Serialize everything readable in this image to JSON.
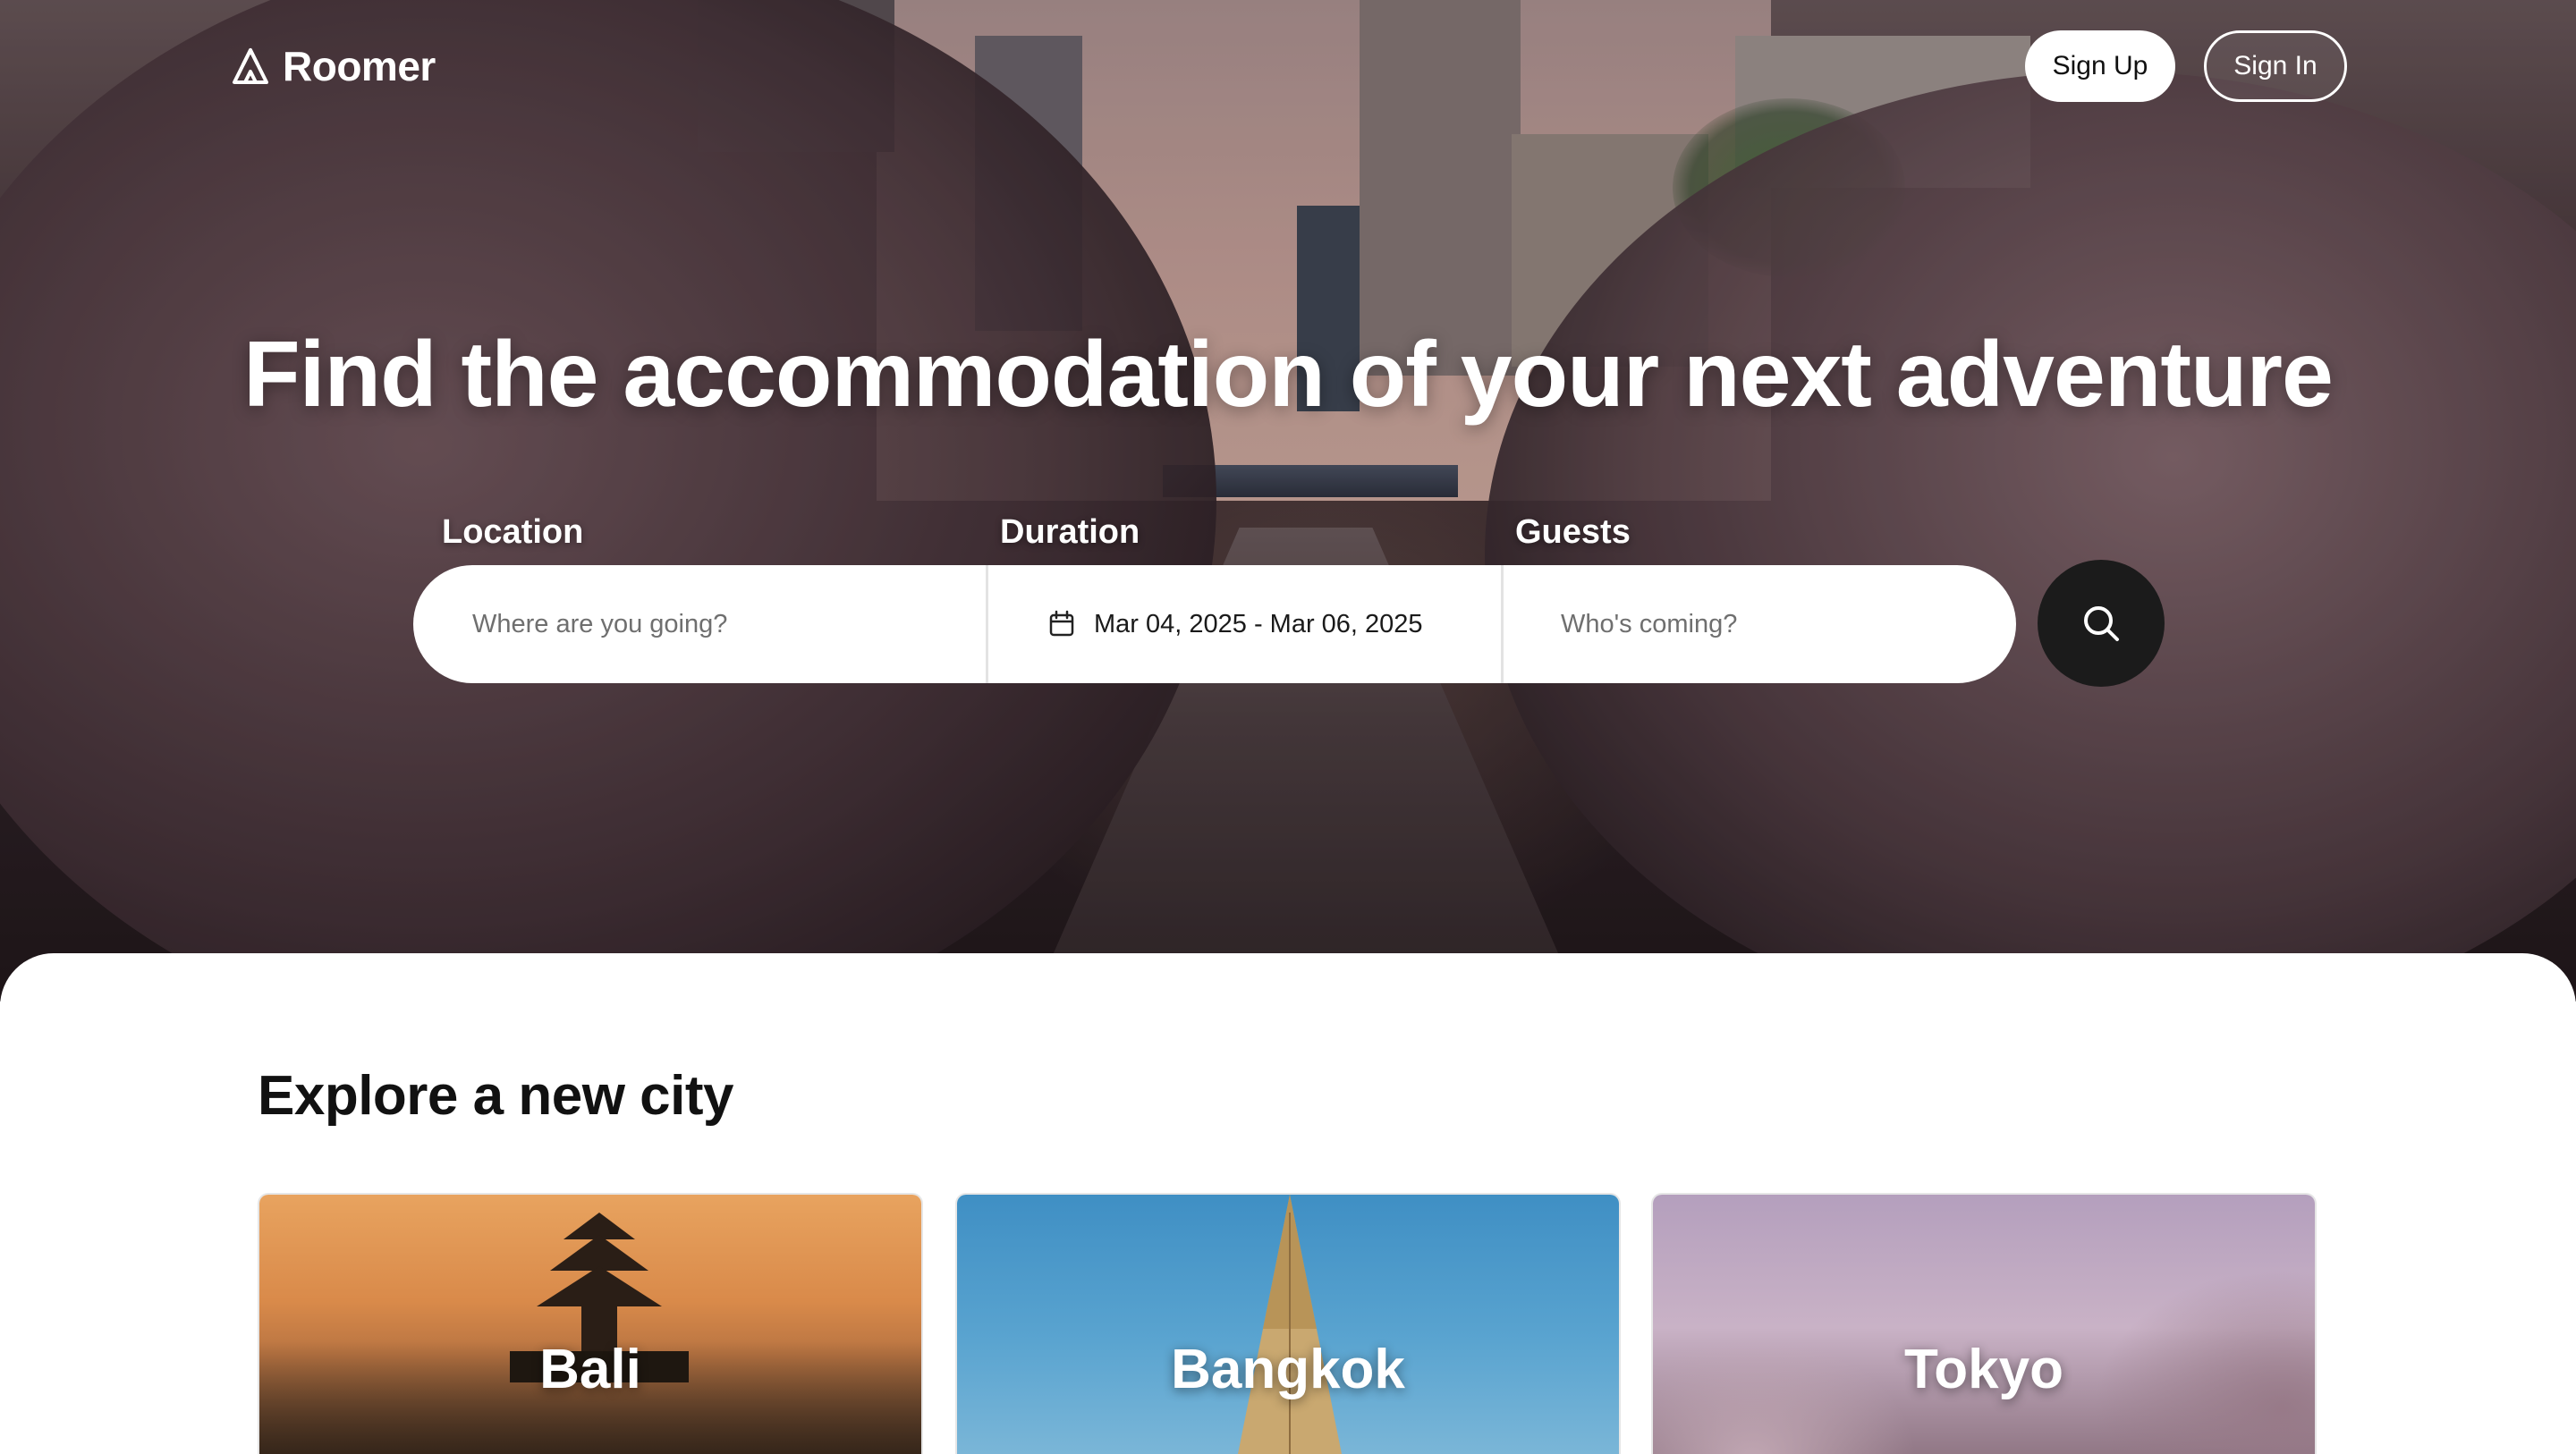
{
  "brand": {
    "name": "Roomer",
    "icon": "tent-icon"
  },
  "nav": {
    "signup_label": "Sign Up",
    "signin_label": "Sign In"
  },
  "hero": {
    "headline": "Find the accommodation of your next adventure"
  },
  "search": {
    "location": {
      "label": "Location",
      "placeholder": "Where are you going?",
      "value": ""
    },
    "duration": {
      "label": "Duration",
      "value": "Mar 04, 2025 - Mar 06, 2025",
      "icon": "calendar-icon"
    },
    "guests": {
      "label": "Guests",
      "placeholder": "Who's coming?",
      "value": ""
    },
    "button_icon": "search-icon"
  },
  "explore": {
    "title": "Explore a new city",
    "cities": [
      {
        "name": "Bali"
      },
      {
        "name": "Bangkok"
      },
      {
        "name": "Tokyo"
      }
    ]
  },
  "colors": {
    "primary_dark": "#1b1b1b",
    "text_dark": "#111111",
    "white": "#ffffff",
    "placeholder": "#6f6f6f"
  }
}
